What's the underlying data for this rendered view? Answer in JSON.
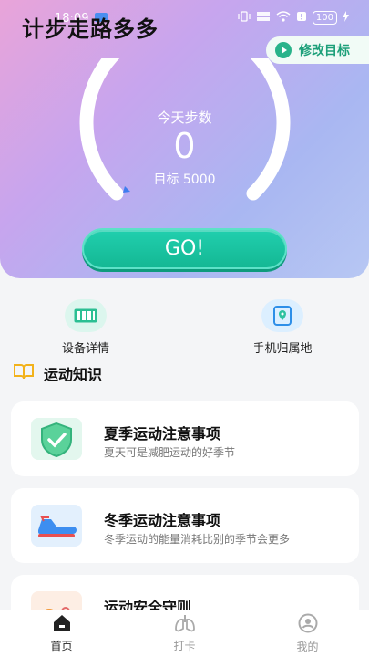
{
  "statusbar": {
    "time": "18:09",
    "battery": "100"
  },
  "app": {
    "title": "计步走路多多"
  },
  "header": {
    "edit_goal_label": "修改目标"
  },
  "pedometer": {
    "today_label": "今天步数",
    "steps": "0",
    "target_text": "目标 5000",
    "progress": 0
  },
  "go_button": {
    "label": "GO!"
  },
  "quick_links": [
    {
      "label": "设备详情",
      "icon": "device-panel-icon"
    },
    {
      "label": "手机归属地",
      "icon": "phone-location-icon"
    }
  ],
  "knowledge": {
    "section_title": "运动知识",
    "items": [
      {
        "title": "夏季运动注意事项",
        "subtitle": "夏天可是减肥运动的好季节",
        "icon": "shield-check-icon"
      },
      {
        "title": "冬季运动注意事项",
        "subtitle": "冬季运动的能量消耗比别的季节会更多",
        "icon": "sneakers-icon"
      },
      {
        "title": "运动安全守则",
        "subtitle": "",
        "icon": "safety-icon"
      }
    ]
  },
  "tabs": [
    {
      "label": "首页",
      "icon": "home-icon",
      "active": true
    },
    {
      "label": "打卡",
      "icon": "lungs-icon",
      "active": false
    },
    {
      "label": "我的",
      "icon": "profile-icon",
      "active": false
    }
  ],
  "colors": {
    "accent": "#1ec4a3",
    "accent_text": "#1ea07a"
  }
}
